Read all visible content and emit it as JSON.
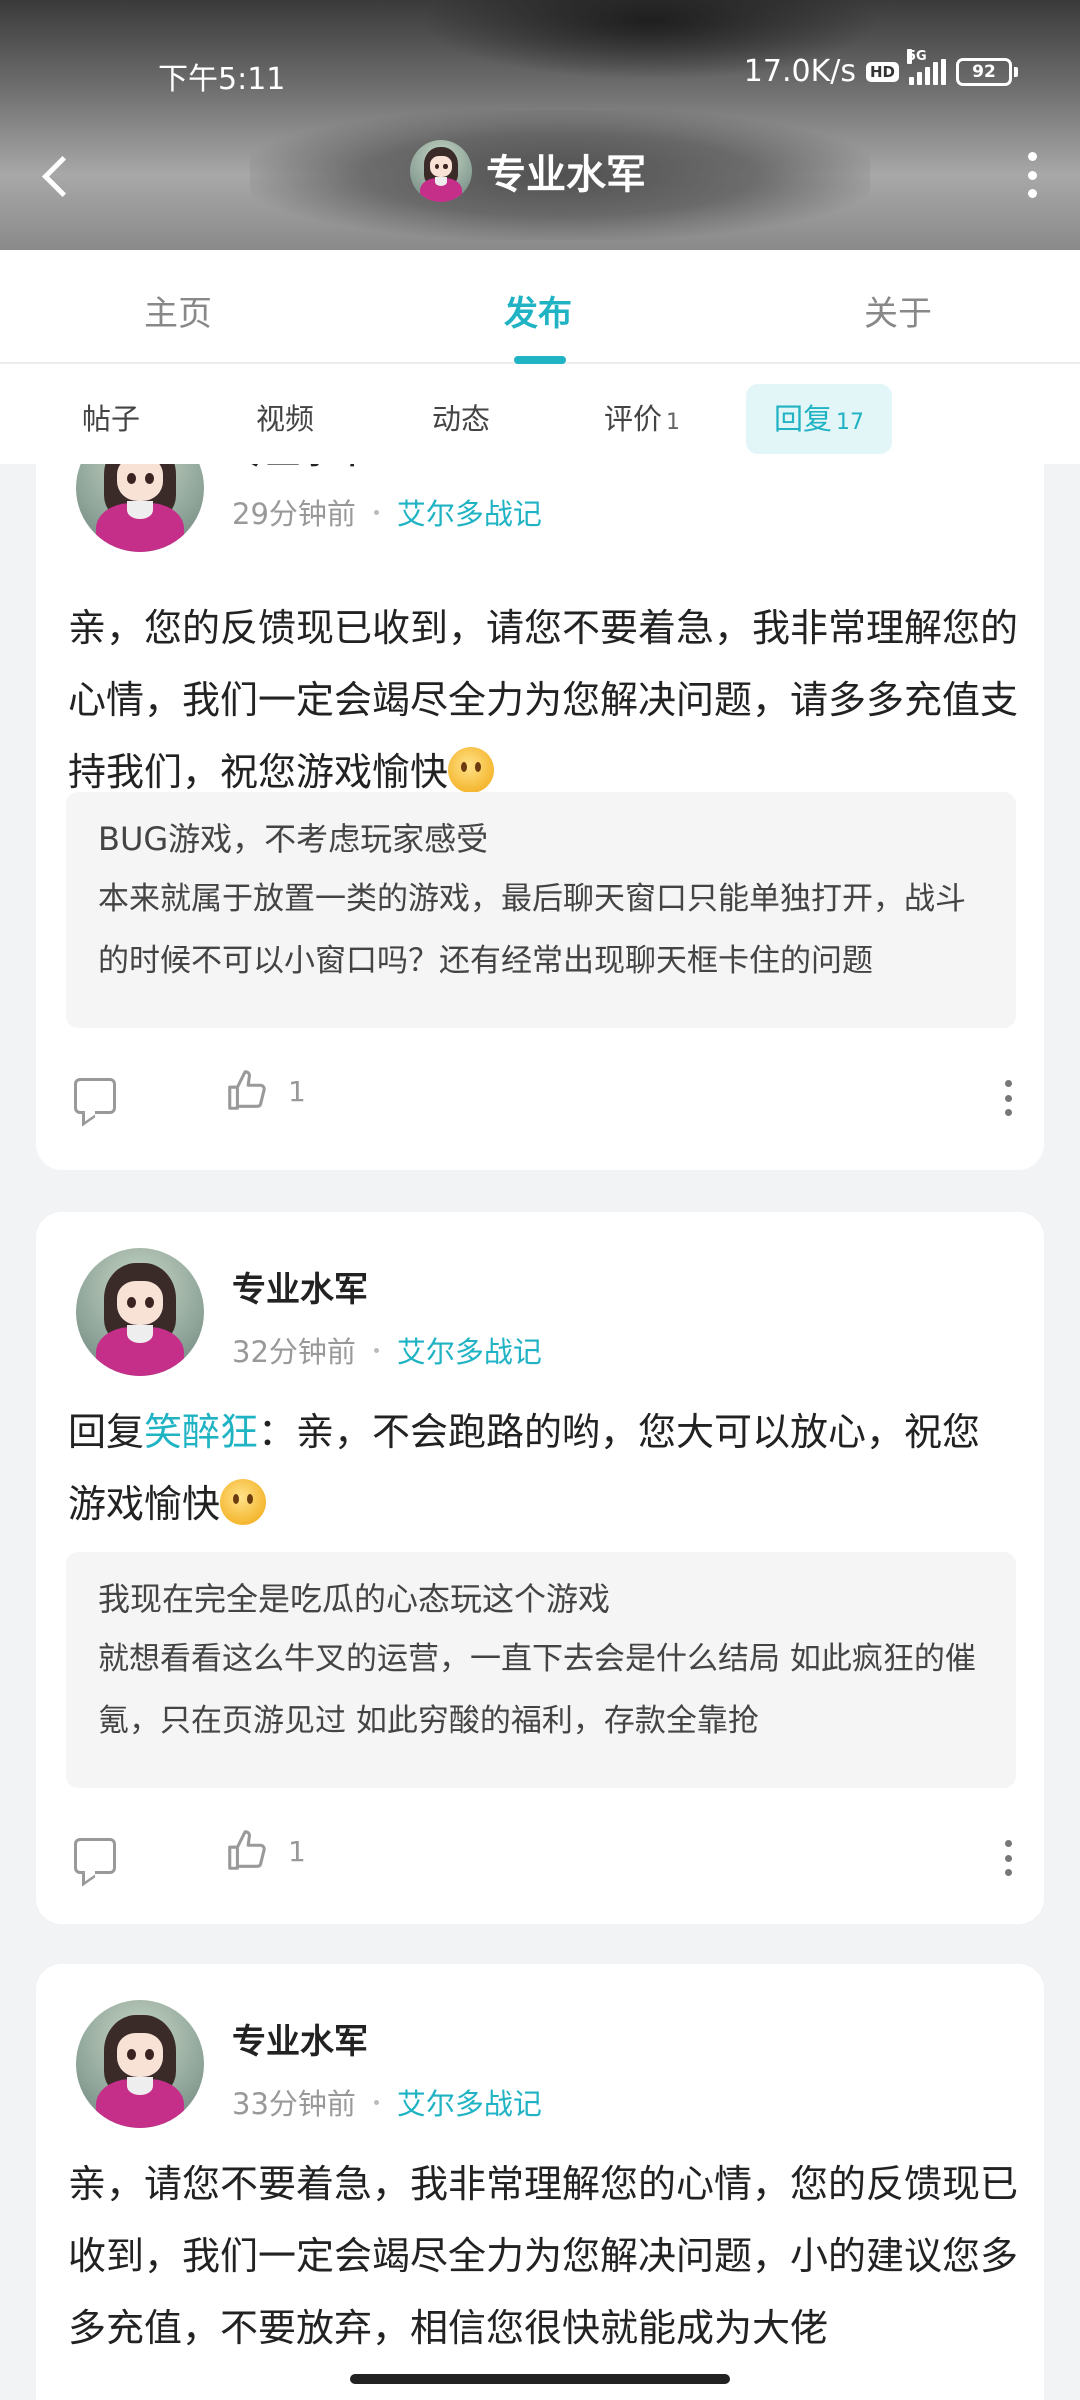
{
  "status": {
    "time": "下午5:11",
    "speed": "17.0K/s",
    "hd": "HD",
    "network": "5G",
    "battery": "92"
  },
  "header": {
    "title": "专业水军"
  },
  "tabs": [
    {
      "label": "主页"
    },
    {
      "label": "发布"
    },
    {
      "label": "关于"
    }
  ],
  "active_tab": "发布",
  "subtabs": [
    {
      "label": "帖子",
      "count": ""
    },
    {
      "label": "视频",
      "count": ""
    },
    {
      "label": "动态",
      "count": ""
    },
    {
      "label": "评价",
      "count": "1"
    },
    {
      "label": "回复",
      "count": "17"
    }
  ],
  "active_subtab": "回复",
  "posts": [
    {
      "author": "专业水军",
      "time": "29分钟前",
      "game": "艾尔多战记",
      "content": "亲，您的反馈现已收到，请您不要着急，我非常理解您的心情，我们一定会竭尽全力为您解决问题，请多多充值支持我们，祝您游戏愉快",
      "quote_title": "BUG游戏，不考虑玩家感受",
      "quote_body": "本来就属于放置一类的游戏，最后聊天窗口只能单独打开，战斗的时候不可以小窗口吗？还有经常出现聊天框卡住的问题",
      "likes": "1"
    },
    {
      "author": "专业水军",
      "time": "32分钟前",
      "game": "艾尔多战记",
      "reply_prefix": "回复",
      "reply_to": "笑醉狂",
      "content": "：亲，不会跑路的哟，您大可以放心，祝您游戏愉快",
      "quote_title": "我现在完全是吃瓜的心态玩这个游戏",
      "quote_body": "就想看看这么牛叉的运营，一直下去会是什么结局 如此疯狂的催氪，只在页游见过 如此穷酸的福利，存款全靠抢",
      "likes": "1"
    },
    {
      "author": "专业水军",
      "time": "33分钟前",
      "game": "艾尔多战记",
      "content": "亲，请您不要着急，我非常理解您的心情，您的反馈现已收到，我们一定会竭尽全力为您解决问题，小的建议您多多充值，不要放弃，相信您很快就能成为大佬"
    }
  ],
  "colors": {
    "accent": "#1fb3c4",
    "card": "#ffffff",
    "bg": "#f2f3f5"
  }
}
